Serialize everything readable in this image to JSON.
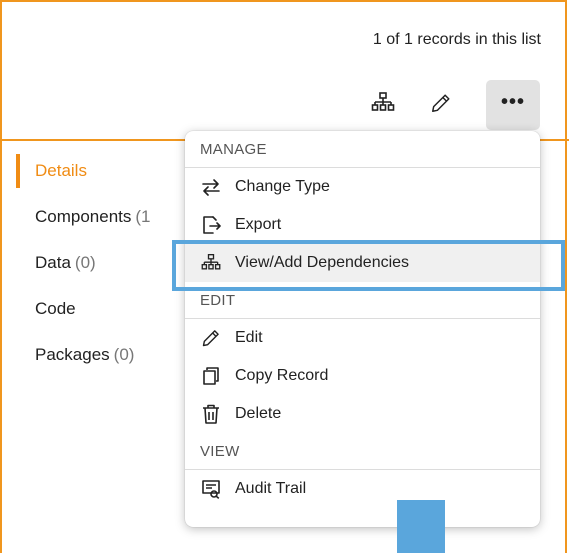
{
  "header": {
    "records_text": "1 of 1 records in this list"
  },
  "toolbar": {
    "dependencies_icon": "hierarchy-icon",
    "edit_icon": "pencil-icon",
    "more_label": "•••"
  },
  "sidebar": {
    "items": [
      {
        "label": "Details",
        "count": ""
      },
      {
        "label": "Components",
        "count": "(1"
      },
      {
        "label": "Data",
        "count": "(0)"
      },
      {
        "label": "Code",
        "count": ""
      },
      {
        "label": "Packages",
        "count": "(0)"
      }
    ]
  },
  "menu": {
    "sections": [
      {
        "title": "MANAGE",
        "items": [
          {
            "label": "Change Type",
            "icon": "swap-arrows-icon"
          },
          {
            "label": "Export",
            "icon": "export-icon"
          },
          {
            "label": "View/Add Dependencies",
            "icon": "hierarchy-icon"
          }
        ]
      },
      {
        "title": "EDIT",
        "items": [
          {
            "label": "Edit",
            "icon": "pencil-icon"
          },
          {
            "label": "Copy Record",
            "icon": "copy-icon"
          },
          {
            "label": "Delete",
            "icon": "trash-icon"
          }
        ]
      },
      {
        "title": "VIEW",
        "items": [
          {
            "label": "Audit Trail",
            "icon": "audit-trail-icon"
          }
        ]
      }
    ]
  },
  "colors": {
    "accent": "#f0961e",
    "callout": "#5aa6dc",
    "menu_hover": "#f0f0f0"
  }
}
